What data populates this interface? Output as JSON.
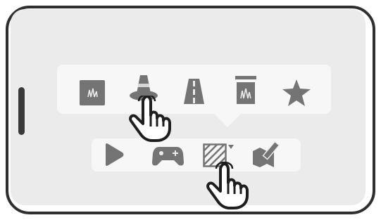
{
  "colors": {
    "icon": "#747474",
    "panel": "#f7f7f7",
    "screen": "#ebebeb",
    "frame": "#2f2f2f"
  },
  "toolbar_top": {
    "items": [
      {
        "icon": "grass-tile-icon"
      },
      {
        "icon": "traffic-cone-icon"
      },
      {
        "icon": "road-icon"
      },
      {
        "icon": "grass-bin-icon"
      },
      {
        "icon": "star-icon"
      }
    ]
  },
  "toolbar_bottom": {
    "items": [
      {
        "icon": "play-icon"
      },
      {
        "icon": "gamepad-icon"
      },
      {
        "icon": "hatched-fill-icon",
        "has_dropdown": true
      },
      {
        "icon": "map-pencil-icon"
      }
    ]
  },
  "gestures": [
    {
      "icon": "tap-hand-icon",
      "target": "traffic-cone-icon"
    },
    {
      "icon": "tap-hand-icon",
      "target": "hatched-fill-icon"
    }
  ]
}
